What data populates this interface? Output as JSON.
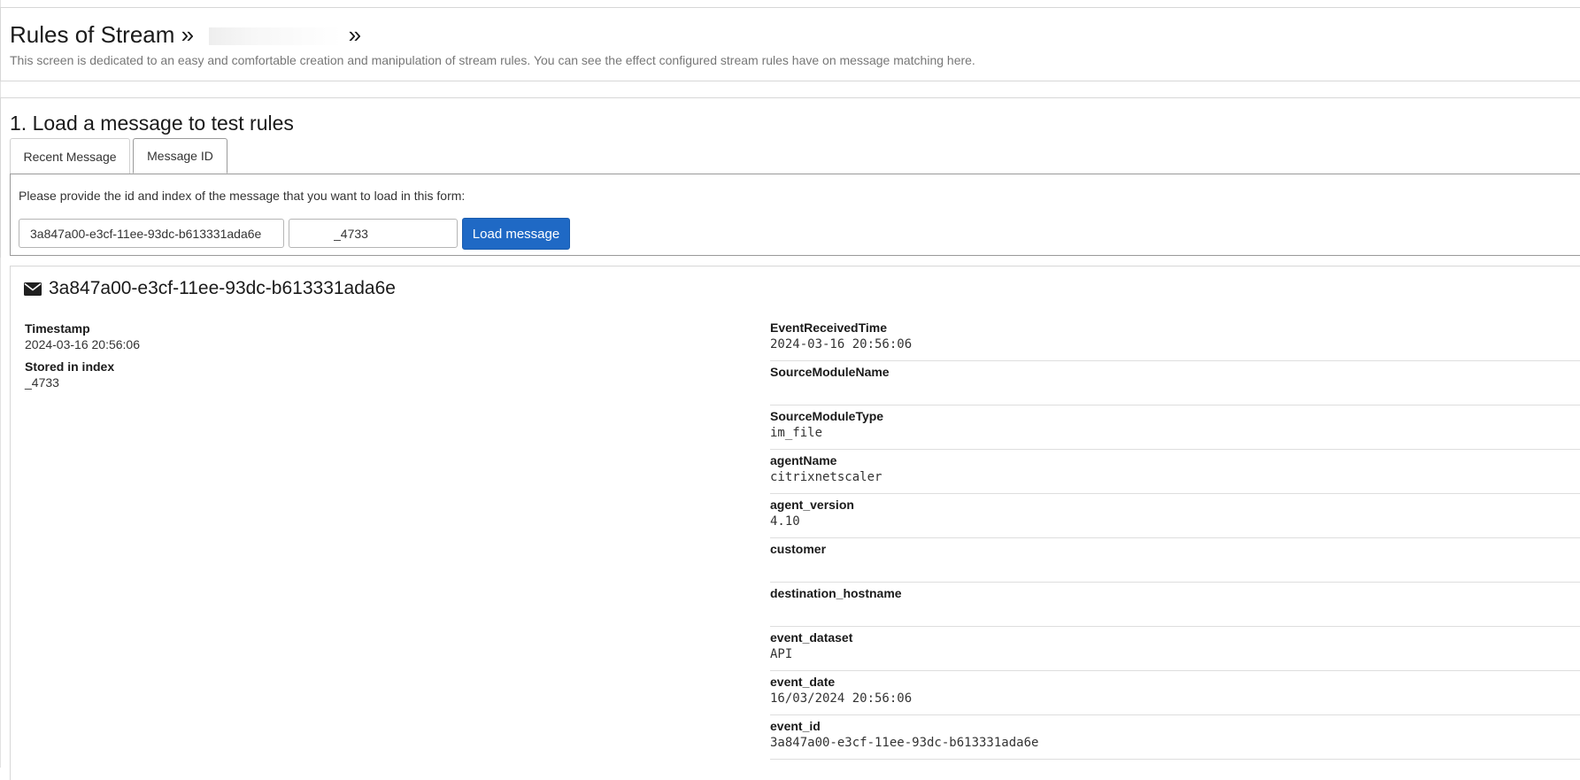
{
  "header": {
    "title_prefix": "Rules of Stream »",
    "title_suffix": "»",
    "description": "This screen is dedicated to an easy and comfortable creation and manipulation of stream rules. You can see the effect configured stream rules have on message matching here."
  },
  "section1": {
    "title": "1. Load a message to test rules",
    "tabs": [
      {
        "label": "Recent Message",
        "active": false
      },
      {
        "label": "Message ID",
        "active": true
      }
    ],
    "instruction": "Please provide the id and index of the message that you want to load in this form:",
    "message_id_value": "3a847a00-e3cf-11ee-93dc-b613331ada6e",
    "index_value": "_4733",
    "load_button_label": "Load message"
  },
  "message": {
    "icon": "envelope-icon",
    "id": "3a847a00-e3cf-11ee-93dc-b613331ada6e",
    "left_fields": [
      {
        "key": "Timestamp",
        "value": "2024-03-16 20:56:06"
      },
      {
        "key": "Stored in index",
        "value": "_4733"
      }
    ],
    "fields": [
      {
        "key": "EventReceivedTime",
        "value": "2024-03-16 20:56:06"
      },
      {
        "key": "SourceModuleName",
        "value": ""
      },
      {
        "key": "SourceModuleType",
        "value": "im_file"
      },
      {
        "key": "agentName",
        "value": "citrixnetscaler"
      },
      {
        "key": "agent_version",
        "value": "4.10"
      },
      {
        "key": "customer",
        "value": ""
      },
      {
        "key": "destination_hostname",
        "value": ""
      },
      {
        "key": "event_dataset",
        "value": "API"
      },
      {
        "key": "event_date",
        "value": "16/03/2024 20:56:06"
      },
      {
        "key": "event_id",
        "value": "3a847a00-e3cf-11ee-93dc-b613331ada6e"
      }
    ]
  },
  "colors": {
    "primary_button": "#1f69c5",
    "muted_text": "#777777",
    "border": "#d7d7d7"
  }
}
